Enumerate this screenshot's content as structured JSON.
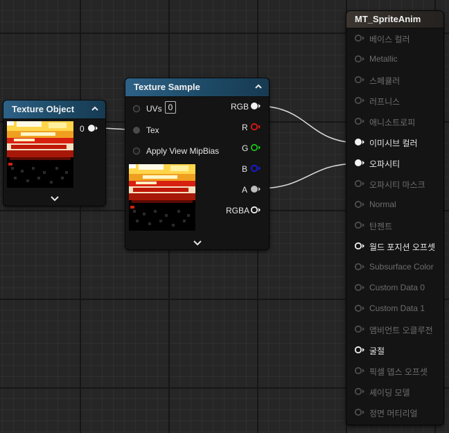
{
  "nodes": {
    "texture_object": {
      "title": "Texture Object",
      "output_label": "0"
    },
    "texture_sample": {
      "title": "Texture Sample",
      "inputs": [
        {
          "label": "UVs",
          "value": "0"
        },
        {
          "label": "Tex"
        },
        {
          "label": "Apply View MipBias"
        }
      ],
      "outputs": [
        "RGB",
        "R",
        "G",
        "B",
        "A",
        "RGBA"
      ]
    },
    "material_result": {
      "title": "MT_SpriteAnim",
      "inputs": [
        {
          "label": "베이스 컬러",
          "active": false
        },
        {
          "label": "Metallic",
          "active": false
        },
        {
          "label": "스페큘러",
          "active": false
        },
        {
          "label": "러프니스",
          "active": false
        },
        {
          "label": "애니소트로피",
          "active": false
        },
        {
          "label": "이미시브 컬러",
          "active": true
        },
        {
          "label": "오파시티",
          "active": true
        },
        {
          "label": "오파시티 마스크",
          "active": false
        },
        {
          "label": "Normal",
          "active": false
        },
        {
          "label": "탄젠트",
          "active": false
        },
        {
          "label": "월드 포지션 오프셋",
          "active": true
        },
        {
          "label": "Subsurface Color",
          "active": false
        },
        {
          "label": "Custom Data 0",
          "active": false
        },
        {
          "label": "Custom Data 1",
          "active": false
        },
        {
          "label": "앰비언트 오클루전",
          "active": false
        },
        {
          "label": "굴절",
          "active": true
        },
        {
          "label": "픽셀 뎁스 오프셋",
          "active": false
        },
        {
          "label": "셰이딩 모델",
          "active": false
        },
        {
          "label": "정면 머티리얼",
          "active": false
        }
      ]
    }
  },
  "icons": [
    "chevron-up-icon",
    "chevron-down-icon",
    "pin-circle-icon",
    "texture-thumbnail"
  ],
  "colors": {
    "header_blue": "#1d4a66",
    "result_header": "#3c3631",
    "wire": "#d8d8d8",
    "pin_r": "#e01818",
    "pin_g": "#18c418",
    "pin_b": "#1a1ae6"
  }
}
